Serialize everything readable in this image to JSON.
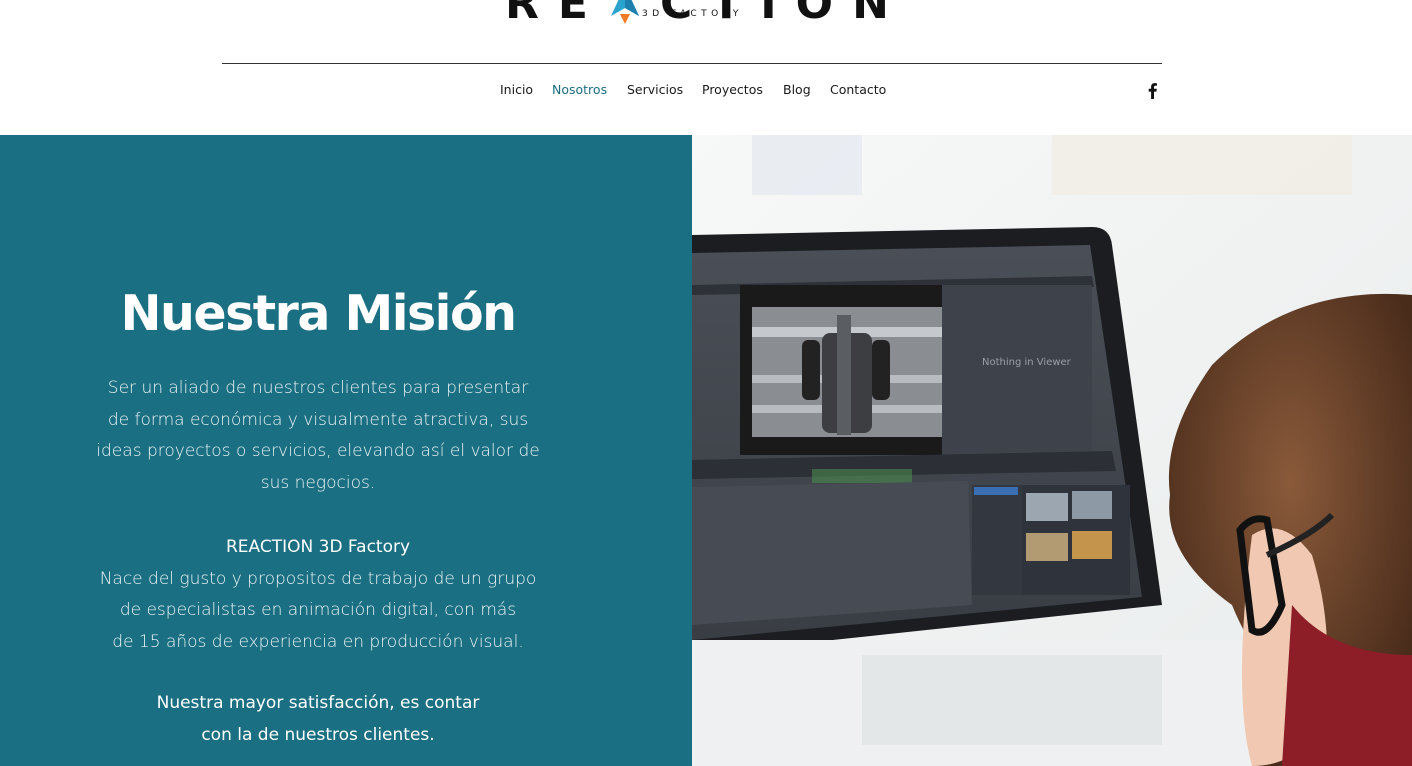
{
  "brand": {
    "name": "REACTION",
    "tagline": "3D FACTORY"
  },
  "nav": {
    "items": [
      "Inicio",
      "Nosotros",
      "Servicios",
      "Proyectos",
      "Blog",
      "Contacto"
    ],
    "active": "Nosotros",
    "social": "facebook-icon"
  },
  "mission": {
    "title": "Nuestra Misión",
    "p1_lines": [
      "Ser un aliado de nuestros clientes para presentar",
      "de forma económica y visualmente atractiva, sus",
      "ideas proyectos o servicios, elevando así el valor de",
      "sus negocios."
    ],
    "p2_heading": "REACTION 3D Factory",
    "p2_lines": [
      "Nace del gusto y propositos de trabajo de un grupo",
      "de especialistas en animación digital, con más",
      "de 15 años de experiencia en producción visual."
    ],
    "p3_lines": [
      "Nuestra mayor satisfacción, es contar",
      "con la de nuestros clientes."
    ]
  },
  "colors": {
    "panel": "#1b6f82",
    "nav_active": "#1d6d80",
    "rocket_blue": "#2aa3cf",
    "rocket_orange": "#f07a26"
  }
}
